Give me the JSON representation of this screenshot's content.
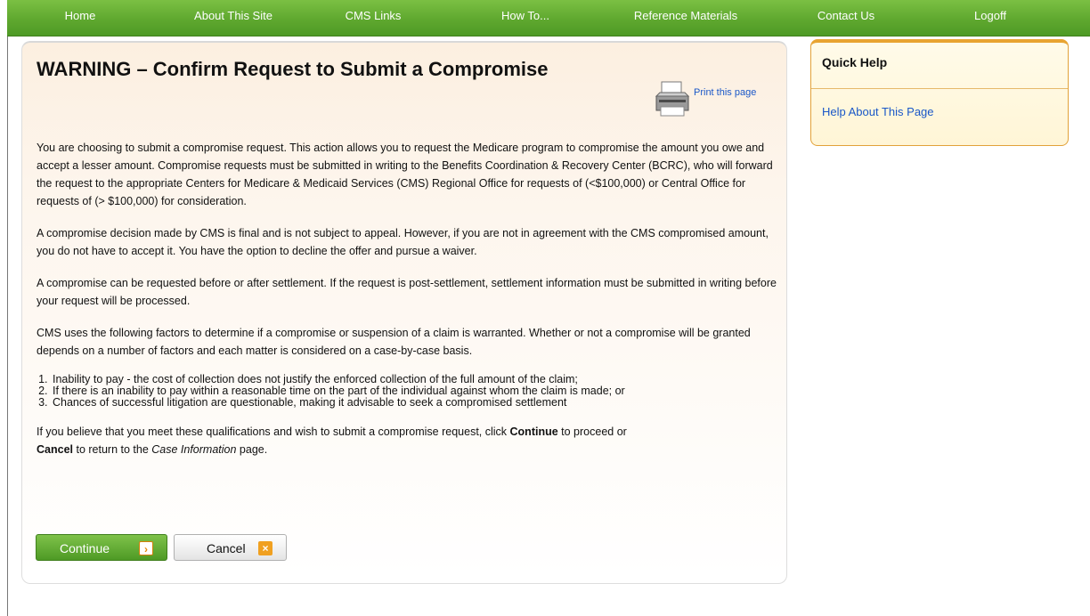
{
  "nav": {
    "items": [
      "Home",
      "About This Site",
      "CMS Links",
      "How To...",
      "Reference Materials",
      "Contact Us",
      "Logoff"
    ]
  },
  "page": {
    "title": "WARNING – Confirm Request to Submit a Compromise",
    "print_label": "Print this page",
    "print_icon": "printer-icon"
  },
  "content": {
    "para1": "You are choosing to submit a compromise request. This action allows you to request the Medicare program to compromise the amount you owe and accept a lesser amount. Compromise requests must be submitted in writing to the Benefits Coordination & Recovery Center (BCRC), who will forward the request to the appropriate Centers for Medicare & Medicaid Services (CMS) Regional Office for requests of (<$100,000) or Central Office for requests of (> $100,000) for consideration.",
    "para2": "A compromise decision made by CMS is final and is not subject to appeal. However, if you are not in agreement with the CMS compromised amount, you do not have to accept it. You have the option to decline the offer and pursue a waiver.",
    "para3": "A compromise can be requested before or after settlement. If the request is post-settlement, settlement information must be submitted in writing before your request will be processed.",
    "para4": "CMS uses the following factors to determine if a compromise or suspension of a claim is warranted. Whether or not a compromise will be granted depends on a number of factors and each matter is considered on a case-by-case basis.",
    "factors": [
      "Inability to pay - the cost of collection does not justify the enforced collection of the full amount of the claim;",
      "If there is an inability to pay within a reasonable time on the part of the individual against whom the claim is made; or",
      "Chances of successful litigation are questionable, making it advisable to seek a compromised settlement"
    ],
    "final": {
      "part1": "If you believe that you meet these qualifications and wish to submit a compromise request, click ",
      "continue_word": "Continue",
      "part2": " to proceed or ",
      "cancel_word": "Cancel",
      "part3": " to return to the ",
      "case_info": "Case Information",
      "part4": " page."
    }
  },
  "buttons": {
    "continue_label": "Continue",
    "continue_icon": "chevron-right-icon",
    "continue_icon_glyph": "›",
    "cancel_label": "Cancel",
    "cancel_icon": "close-icon",
    "cancel_icon_glyph": "×"
  },
  "quick_help": {
    "title": "Quick Help",
    "link": "Help About This Page"
  },
  "colors": {
    "nav_green": "#5fa82f",
    "link_blue": "#1a57c8",
    "quick_help_border": "#e8a431",
    "cancel_icon_orange": "#f0a020"
  }
}
